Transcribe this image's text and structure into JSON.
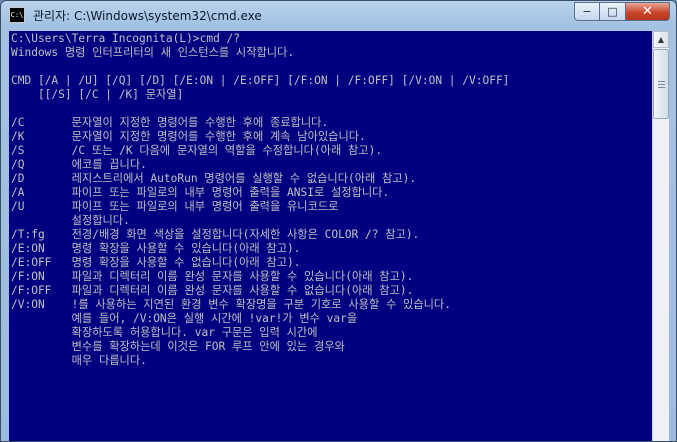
{
  "window": {
    "title": "관리자: C:\\Windows\\system32\\cmd.exe",
    "icon_label": "C:\\",
    "controls": {
      "minimize": "−",
      "maximize": "□",
      "close": "✕"
    }
  },
  "console": {
    "lines": [
      "C:\\Users\\Terra Incognita(L)>cmd /?",
      "Windows 명령 인터프리터의 새 인스턴스를 시작합니다.",
      "",
      "CMD [/A | /U] [/Q] [/D] [/E:ON | /E:OFF] [/F:ON | /F:OFF] [/V:ON | /V:OFF]",
      "    [[/S] [/C | /K] 문자열]",
      "",
      "/C       문자열이 지정한 명령어를 수행한 후에 종료합니다.",
      "/K       문자열이 지정한 명령어를 수행한 후에 계속 남아있습니다.",
      "/S       /C 또는 /K 다음에 문자열의 역할을 수정합니다(아래 참고).",
      "/Q       에코를 끕니다.",
      "/D       레지스트리에서 AutoRun 명령어를 실행할 수 없습니다(아래 참고).",
      "/A       파이프 또는 파일로의 내부 명령어 출력을 ANSI로 설정합니다.",
      "/U       파이프 또는 파일로의 내부 명령어 출력을 유니코드로",
      "         설정합니다.",
      "/T:fg    전경/배경 화면 색상을 설정합니다(자세한 사항은 COLOR /? 참고).",
      "/E:ON    명령 확장을 사용할 수 있습니다(아래 참고).",
      "/E:OFF   명령 확장을 사용할 수 없습니다(아래 참고).",
      "/F:ON    파일과 디렉터리 이름 완성 문자를 사용할 수 있습니다(아래 참고).",
      "/F:OFF   파일과 디렉터리 이름 완성 문자를 사용할 수 없습니다(아래 참고).",
      "/V:ON    !를 사용하는 지연된 환경 변수 확장명을 구분 기호로 사용할 수 있습니다.",
      "         예를 들어, /V:ON은 실행 시간에 !var!가 변수 var을",
      "         확장하도록 허용합니다. var 구문은 입력 시간에",
      "         변수를 확장하는데 이것은 FOR 루프 안에 있는 경우와",
      "         매우 다릅니다."
    ]
  },
  "scrollbar": {
    "up_arrow": "▲"
  },
  "colors": {
    "console_bg": "#000080",
    "console_fg": "#c0c0c0",
    "title_fg": "#0b1a2e",
    "close_red": "#c9462c"
  }
}
